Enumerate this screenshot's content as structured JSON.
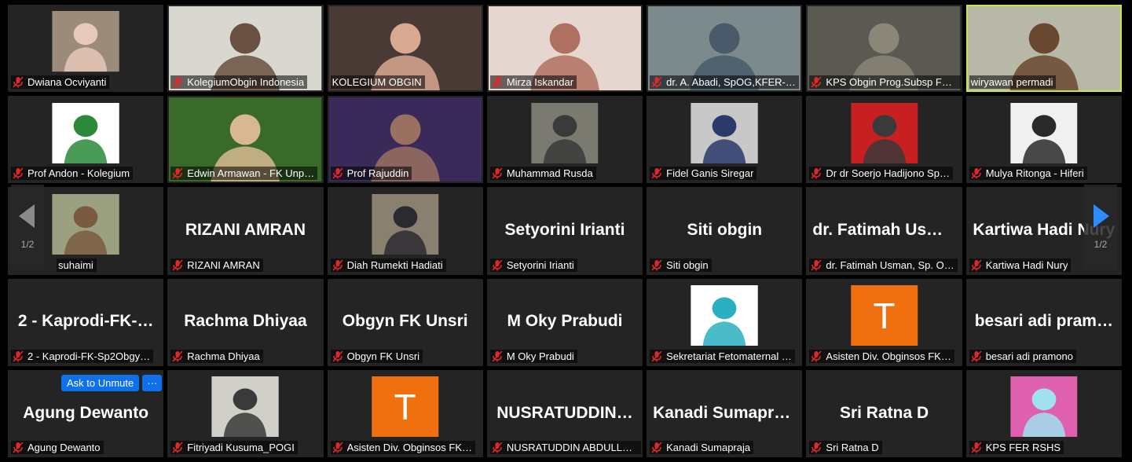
{
  "tiles": [
    {
      "label": "Dwiana Ocviyanti",
      "video": "photo",
      "bg": "#9c8a7a",
      "fg": "#e8c8b8"
    },
    {
      "label": "KolegiumObgin Indonesia",
      "video": "wide",
      "bg": "#d8d8d0",
      "fg": "#6a5040"
    },
    {
      "label": "KOLEGIUM OBGIN",
      "video": "wide",
      "bg": "#4a3a36",
      "fg": "#d8a890",
      "muted": false
    },
    {
      "label": "Mirza Iskandar",
      "video": "wide",
      "bg": "#e6d6d0",
      "fg": "#b07060"
    },
    {
      "label": "dr. A. Abadi, SpOG,KFER-…",
      "video": "wide",
      "bg": "#7c8a8c",
      "fg": "#4a5a6a"
    },
    {
      "label": "KPS Obgin Prog.Subsp FK…",
      "video": "wide",
      "bg": "#5a5a52",
      "fg": "#8a8678"
    },
    {
      "label": "wiryawan permadi",
      "video": "wide",
      "bg": "#b8b8a8",
      "fg": "#6a4830",
      "muted": false,
      "active": true
    },
    {
      "label": "Prof Andon - Kolegium",
      "video": "photo",
      "bg": "#ffffff",
      "fg": "#2a8a3a"
    },
    {
      "label": "Edwin Armawan - FK Unp…",
      "video": "wide",
      "bg": "#3a6a2a",
      "fg": "#d8b890"
    },
    {
      "label": "Prof Rajuddin",
      "video": "wide",
      "bg": "#3a2a5a",
      "fg": "#9a7060"
    },
    {
      "label": "Muhammad Rusda",
      "video": "photo",
      "bg": "#7a7a70",
      "fg": "#3a3a3a"
    },
    {
      "label": "Fidel Ganis Siregar",
      "video": "photo",
      "bg": "#c8c8c8",
      "fg": "#2a3a6a"
    },
    {
      "label": "Dr dr Soerjo Hadijono Sp…",
      "video": "photo",
      "bg": "#c82020",
      "fg": "#3a3a3a"
    },
    {
      "label": "Mulya Ritonga - Hiferi",
      "video": "photo",
      "bg": "#f0f0f0",
      "fg": "#2a2a2a"
    },
    {
      "label": "suhaimi",
      "video": "photo",
      "bg": "#9aa080",
      "fg": "#7a5a40",
      "noMic": true
    },
    {
      "label": "RIZANI AMRAN",
      "big": "RIZANI AMRAN"
    },
    {
      "label": "Diah Rumekti Hadiati",
      "video": "photo",
      "bg": "#8a8070",
      "fg": "#2a2a30"
    },
    {
      "label": "Setyorini Irianti",
      "big": "Setyorini Irianti"
    },
    {
      "label": "Siti obgin",
      "big": "Siti obgin"
    },
    {
      "label": "dr. Fatimah Usman, Sp. O…",
      "big": "dr. Fatimah Usm…"
    },
    {
      "label": "Kartiwa Hadi Nury",
      "big": "Kartiwa Hadi Nury"
    },
    {
      "label": "2 - Kaprodi-FK-Sp2Obgy…",
      "big": "2 - Kaprodi-FK-…"
    },
    {
      "label": "Rachma Dhiyaa",
      "big": "Rachma Dhiyaa"
    },
    {
      "label": "Obgyn FK Unsri",
      "big": "Obgyn FK Unsri"
    },
    {
      "label": "M Oky Prabudi",
      "big": "M Oky Prabudi"
    },
    {
      "label": "Sekretariat Fetomaternal …",
      "video": "photo",
      "bg": "#ffffff",
      "fg": "#2ab0c0"
    },
    {
      "label": "Asisten Div. Obginsos FK…",
      "video": "letter",
      "bg": "#f07010",
      "fg": "#ffffff",
      "letter": "T"
    },
    {
      "label": "besari adi pramono",
      "big": "besari adi pram…"
    },
    {
      "label": "Agung Dewanto",
      "big": "Agung Dewanto",
      "unmute": true
    },
    {
      "label": "Fitriyadi Kusuma_POGI",
      "video": "photo",
      "bg": "#d0d0c8",
      "fg": "#3a3a3a"
    },
    {
      "label": "Asisten Div. Obginsos FK…",
      "video": "letter",
      "bg": "#f07010",
      "fg": "#ffffff",
      "letter": "T"
    },
    {
      "label": "NUSRATUDDIN ABDULLA…",
      "big": "NUSRATUDDIN…"
    },
    {
      "label": "Kanadi Sumapraja",
      "big": "Kanadi Sumapraja"
    },
    {
      "label": "Sri Ratna D",
      "big": "Sri Ratna D"
    },
    {
      "label": "KPS FER RSHS",
      "video": "photo",
      "bg": "#e060b0",
      "fg": "#a0e0f0"
    }
  ],
  "controls": {
    "ask_to_unmute": "Ask to Unmute",
    "more": "···"
  },
  "pager": {
    "left_page": "1/2",
    "right_page": "1/2"
  },
  "colors": {
    "muted_icon": "#e02828",
    "active_border": "#c8e64a",
    "next_arrow": "#2d8cff"
  }
}
